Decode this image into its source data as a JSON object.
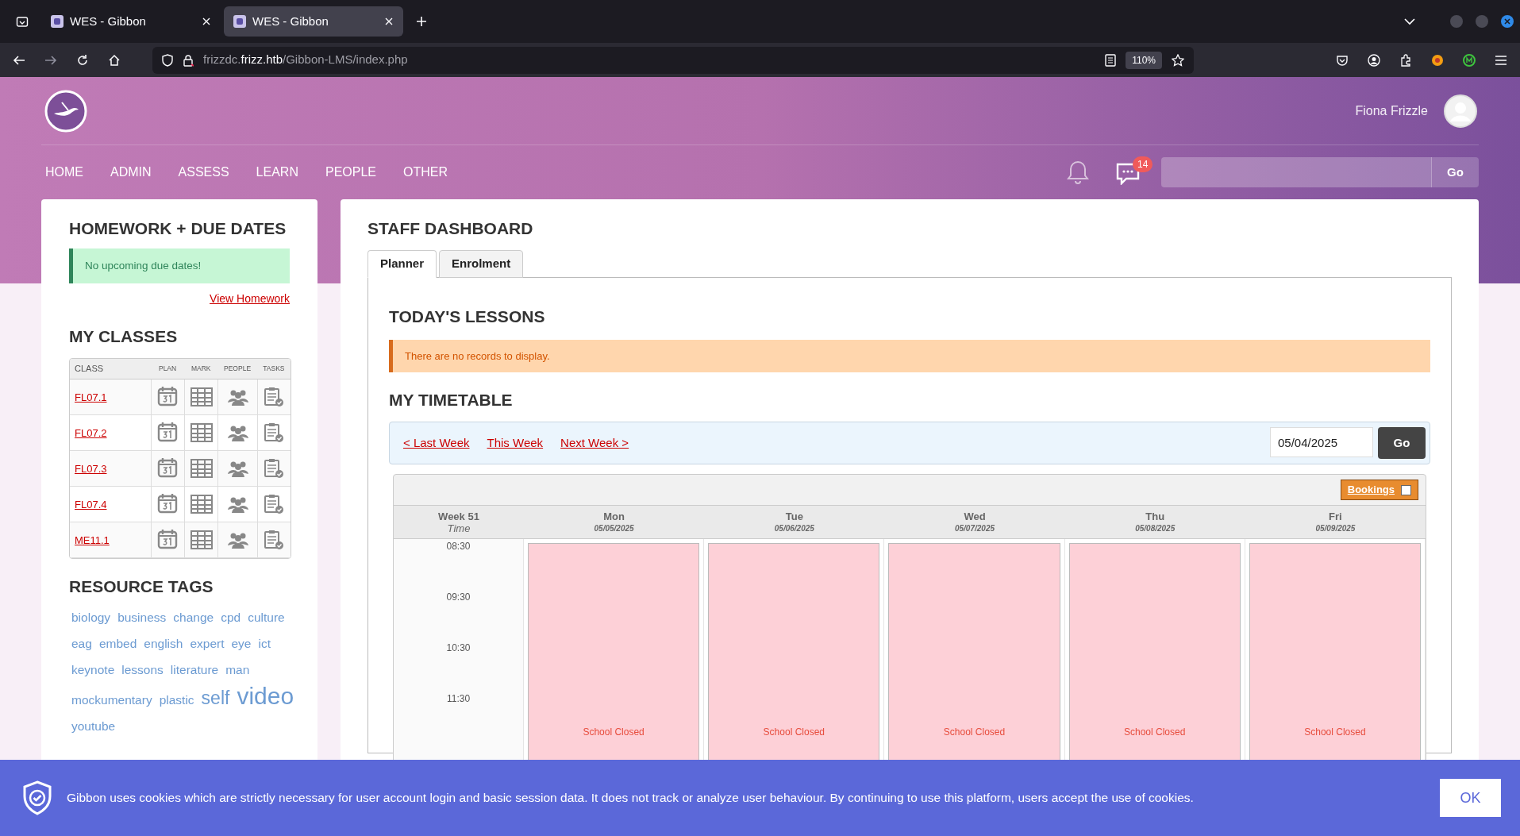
{
  "browser": {
    "tabs": [
      {
        "title": "WES - Gibbon",
        "selected": false
      },
      {
        "title": "WES - Gibbon",
        "selected": true
      }
    ],
    "url": "frizzdc.**frizz.htb**/Gibbon-LMS/index.php",
    "zoom": "110%"
  },
  "header": {
    "user_name": "Fiona Frizzle",
    "nav": [
      "HOME",
      "ADMIN",
      "ASSESS",
      "LEARN",
      "PEOPLE",
      "OTHER"
    ],
    "message_count": "14",
    "search_button": "Go"
  },
  "sidebar": {
    "homework_title": "HOMEWORK + DUE DATES",
    "homework_alert": "No upcoming due dates!",
    "homework_link": "View Homework",
    "classes_title": "MY CLASSES",
    "class_columns": [
      "CLASS",
      "PLAN",
      "MARK",
      "PEOPLE",
      "TASKS"
    ],
    "classes": [
      "FL07.1",
      "FL07.2",
      "FL07.3",
      "FL07.4",
      "ME11.1"
    ],
    "tags_title": "RESOURCE TAGS",
    "tags": [
      {
        "label": "biology",
        "kind": "normal"
      },
      {
        "label": "business",
        "kind": "normal"
      },
      {
        "label": "change",
        "kind": "normal"
      },
      {
        "label": "cpd",
        "kind": "normal"
      },
      {
        "label": "culture",
        "kind": "normal"
      },
      {
        "label": "eag",
        "kind": "normal"
      },
      {
        "label": "embed",
        "kind": "normal"
      },
      {
        "label": "english",
        "kind": "normal"
      },
      {
        "label": "expert",
        "kind": "normal"
      },
      {
        "label": "eye",
        "kind": "normal"
      },
      {
        "label": "ict",
        "kind": "normal"
      },
      {
        "label": "keynote",
        "kind": "normal"
      },
      {
        "label": "lessons",
        "kind": "normal"
      },
      {
        "label": "literature",
        "kind": "normal"
      },
      {
        "label": "man",
        "kind": "normal"
      },
      {
        "label": "mockumentary",
        "kind": "normal"
      },
      {
        "label": "plastic",
        "kind": "normal"
      },
      {
        "label": "self",
        "kind": "large"
      },
      {
        "label": "video",
        "kind": "largest"
      },
      {
        "label": "youtube",
        "kind": "normal"
      }
    ]
  },
  "main": {
    "title": "STAFF DASHBOARD",
    "tabs": [
      {
        "label": "Planner",
        "selected": true
      },
      {
        "label": "Enrolment",
        "selected": false
      }
    ],
    "lessons_title": "TODAY'S LESSONS",
    "lessons_message": "There are no records to display.",
    "timetable_title": "MY TIMETABLE",
    "week_links": [
      "< Last Week",
      "This Week",
      "Next Week >"
    ],
    "date": "05/04/2025",
    "go_button": "Go",
    "bookings": {
      "label": "Bookings",
      "checked": false
    },
    "week": "Week 51",
    "time_label": "Time",
    "days": [
      {
        "name": "Mon",
        "date": "05/05/2025",
        "status": "School Closed"
      },
      {
        "name": "Tue",
        "date": "05/06/2025",
        "status": "School Closed"
      },
      {
        "name": "Wed",
        "date": "05/07/2025",
        "status": "School Closed"
      },
      {
        "name": "Thu",
        "date": "05/08/2025",
        "status": "School Closed"
      },
      {
        "name": "Fri",
        "date": "05/09/2025",
        "status": "School Closed"
      }
    ],
    "times": [
      "08:30",
      "09:30",
      "10:30",
      "11:30"
    ]
  },
  "cookie_notice": {
    "text": "Gibbon uses cookies which are strictly necessary for user account login and basic session data. It does not track or analyze user behaviour. By continuing to use this platform, users accept the use of cookies.",
    "button": "OK"
  }
}
